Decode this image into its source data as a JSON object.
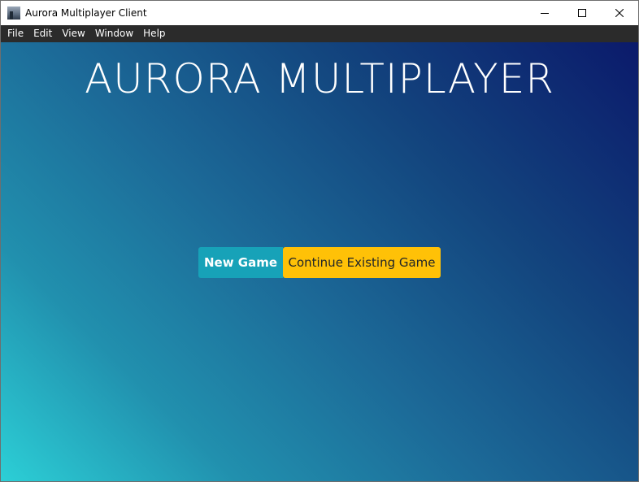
{
  "window": {
    "title": "Aurora Multiplayer Client",
    "controls": {
      "minimize_icon": "minimize-icon",
      "maximize_icon": "maximize-icon",
      "close_icon": "close-icon"
    }
  },
  "menubar": {
    "items": [
      {
        "label": "File"
      },
      {
        "label": "Edit"
      },
      {
        "label": "View"
      },
      {
        "label": "Window"
      },
      {
        "label": "Help"
      }
    ]
  },
  "main": {
    "title": "AURORA MULTIPLAYER",
    "buttons": {
      "new_game": "New Game",
      "continue_game": "Continue Existing Game"
    }
  },
  "colors": {
    "new_game_button": "#17a2b8",
    "continue_button": "#ffc107",
    "gradient_top_right": "#0b1a6b",
    "gradient_bottom_left": "#2ccfd6",
    "menubar_bg": "#2b2b2b"
  }
}
